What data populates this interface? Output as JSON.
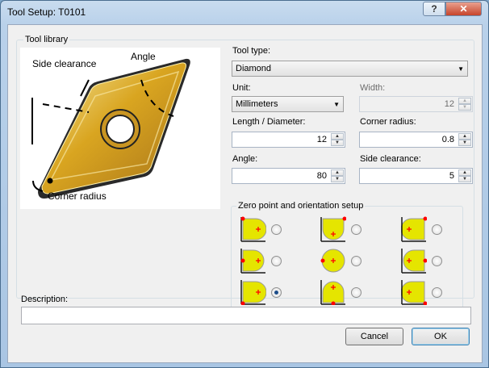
{
  "window": {
    "title": "Tool Setup: T0101",
    "help_label": "?",
    "close_label": "✕"
  },
  "tool_library": {
    "group_label": "Tool library",
    "picture_labels": {
      "side_clearance": "Side clearance",
      "angle": "Angle",
      "corner_radius": "Corner radius"
    }
  },
  "form": {
    "tool_type_label": "Tool type:",
    "tool_type_value": "Diamond",
    "unit_label": "Unit:",
    "unit_value": "Millimeters",
    "width_label": "Width:",
    "width_value": "12",
    "length_label": "Length / Diameter:",
    "length_value": "12",
    "corner_radius_label": "Corner radius:",
    "corner_radius_value": "0.8",
    "angle_label": "Angle:",
    "angle_value": "80",
    "side_clearance_label": "Side clearance:",
    "side_clearance_value": "5"
  },
  "zero_point": {
    "group_label": "Zero point and orientation setup",
    "selected_index": 6
  },
  "description": {
    "label": "Description:",
    "value": ""
  },
  "buttons": {
    "cancel": "Cancel",
    "ok": "OK"
  },
  "colors": {
    "tile_fill": "#e5e500",
    "marker": "#ff0000",
    "insert_gold": "#d9a520"
  }
}
